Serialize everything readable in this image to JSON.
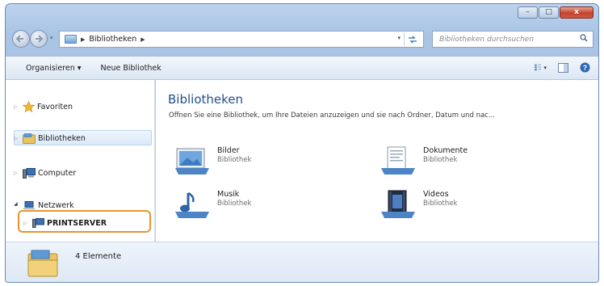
{
  "window": {
    "caption_buttons": {
      "minimize": "–",
      "maximize": "□",
      "close": "x"
    }
  },
  "address": {
    "crumb": "Bibliotheken",
    "search_placeholder": "Bibliotheken durchsuchen"
  },
  "toolbar": {
    "organize": "Organisieren ▾",
    "new_library": "Neue Bibliothek"
  },
  "nav": {
    "favorites": "Favoriten",
    "libraries": "Bibliotheken",
    "computer": "Computer",
    "network": "Netzwerk",
    "printserver": "PRINTSERVER"
  },
  "content": {
    "title": "Bibliotheken",
    "description": "Öffnen Sie eine Bibliothek, um Ihre Dateien anzuzeigen und sie nach Ordner, Datum und nac...",
    "libraries": [
      {
        "name": "Bilder",
        "type": "Bibliothek",
        "icon": "pictures-library-icon"
      },
      {
        "name": "Dokumente",
        "type": "Bibliothek",
        "icon": "documents-library-icon"
      },
      {
        "name": "Musik",
        "type": "Bibliothek",
        "icon": "music-library-icon"
      },
      {
        "name": "Videos",
        "type": "Bibliothek",
        "icon": "videos-library-icon"
      }
    ]
  },
  "details": {
    "count": "4 Elemente"
  },
  "colors": {
    "title_blue": "#1f4f8a",
    "highlight_orange": "#e8952f",
    "close_red": "#c5432c"
  }
}
